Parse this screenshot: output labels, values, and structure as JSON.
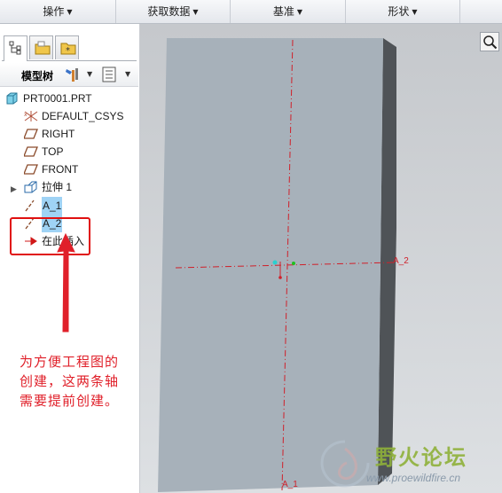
{
  "menubar": {
    "items": [
      {
        "label": "操作"
      },
      {
        "label": "获取数据"
      },
      {
        "label": "基准"
      },
      {
        "label": "形状"
      }
    ]
  },
  "panel": {
    "tabs": [
      "model-tree-tab",
      "folder-browser-tab",
      "favorites-tab"
    ],
    "header_label": "模型树",
    "tree": [
      {
        "label": "PRT0001.PRT",
        "icon": "part-icon"
      },
      {
        "label": "DEFAULT_CSYS",
        "icon": "csys-icon"
      },
      {
        "label": "RIGHT",
        "icon": "datum-plane-icon"
      },
      {
        "label": "TOP",
        "icon": "datum-plane-icon"
      },
      {
        "label": "FRONT",
        "icon": "datum-plane-icon"
      },
      {
        "label": "拉伸 1",
        "icon": "extrude-icon"
      },
      {
        "label": "A_1",
        "icon": "datum-axis-icon",
        "selected": true
      },
      {
        "label": "A_2",
        "icon": "datum-axis-icon",
        "selected": true
      },
      {
        "label": "在此插入",
        "icon": "insert-here-arrow-icon"
      }
    ]
  },
  "viewport": {
    "axis_labels": {
      "horizontal": "A_2",
      "vertical_bottom": "A_1"
    }
  },
  "annotation": {
    "lines": [
      "为方便工程图的",
      "创建，这两条轴",
      "需要提前创建。"
    ],
    "color": "#e0202a"
  },
  "watermark": {
    "title": "野火论坛",
    "url": "www.proewildfire.cn"
  },
  "colors": {
    "selection": "#9fd3f5",
    "highlight_box": "#e01010",
    "datum_axis": "#d0202a",
    "part_face": "#a7b1ba"
  }
}
